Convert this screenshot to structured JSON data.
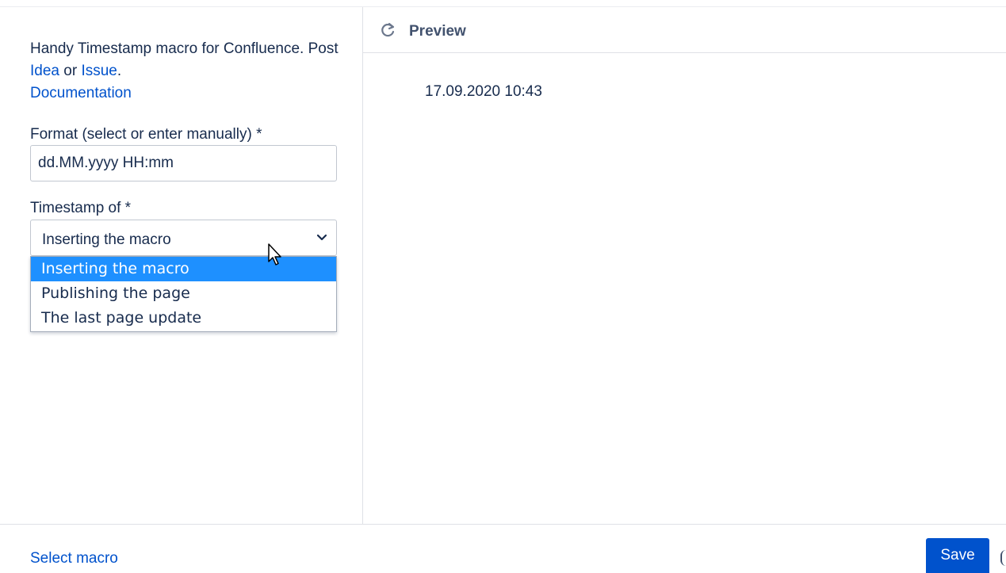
{
  "description": {
    "text_1": "Handy Timestamp macro for Confluence. Post ",
    "idea_link": "Idea",
    "text_2": " or ",
    "issue_link": "Issue",
    "text_3": ".",
    "documentation_link": "Documentation"
  },
  "format": {
    "label": "Format (select or enter manually) *",
    "value": "dd.MM.yyyy HH:mm"
  },
  "timestamp_of": {
    "label": "Timestamp of *",
    "selected": "Inserting the macro",
    "options": [
      "Inserting the macro",
      "Publishing the page",
      "The last page update"
    ]
  },
  "preview": {
    "title": "Preview",
    "value": "17.09.2020 10:43",
    "icon": "refresh-icon"
  },
  "footer": {
    "select_macro_label": "Select macro",
    "save_label": "Save"
  },
  "colors": {
    "link": "#0052cc",
    "primary_button": "#0052cc",
    "option_highlight": "#1e90ff"
  }
}
